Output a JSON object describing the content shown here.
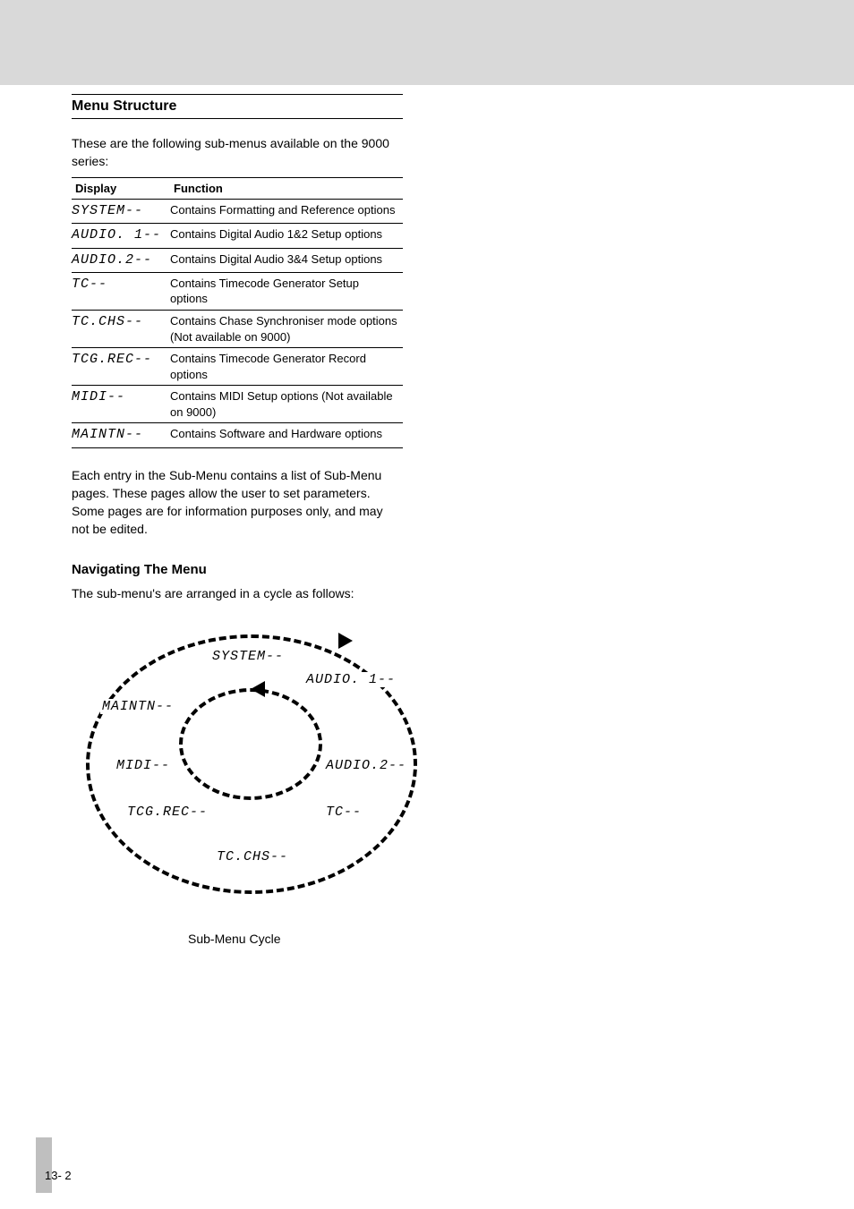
{
  "header": {
    "title": "Menu Structure"
  },
  "intro": "These are the following sub-menus available on the 9000 series:",
  "menu_table": {
    "col1": "Display",
    "col2": "Function",
    "rows": [
      {
        "code": "SYSTEM--",
        "desc": "Contains Formatting and Reference options"
      },
      {
        "code": "AUDIO. 1--",
        "desc": "Contains Digital Audio 1&2 Setup options"
      },
      {
        "code": "AUDIO.2--",
        "desc": "Contains Digital Audio 3&4 Setup options"
      },
      {
        "code": "TC--",
        "desc": "Contains Timecode Generator Setup options"
      },
      {
        "code": "TC.CHS--",
        "desc": "Contains Chase Synchroniser mode options (Not available on 9000)"
      },
      {
        "code": "TCG.REC--",
        "desc": "Contains Timecode Generator Record options"
      },
      {
        "code": "MIDI--",
        "desc": "Contains MIDI Setup options (Not available on 9000)"
      },
      {
        "code": "MAINTN--",
        "desc": "Contains Software and Hardware options"
      }
    ]
  },
  "after": "Each entry in the Sub-Menu contains a list of Sub-Menu pages. These pages allow the user to set parameters. Some pages are for information purposes only, and may not be edited.",
  "subtitle": "Navigating The Menu",
  "cycle_note": "The sub-menu's are arranged in a cycle as follows:",
  "diagram_labels": {
    "system": "SYSTEM--",
    "audio1": "AUDIO. 1--",
    "audio2": "AUDIO.2--",
    "tc": "TC--",
    "tcchs": "TC.CHS--",
    "tcgrec": "TCG.REC--",
    "midi": "MIDI--",
    "maintn": "MAINTN--"
  },
  "caption": "Sub-Menu Cycle",
  "page_number": "13- 2"
}
